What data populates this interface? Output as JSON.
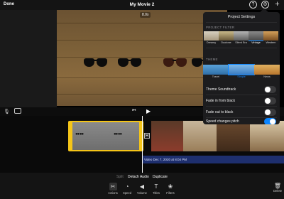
{
  "header": {
    "done_label": "Done",
    "title": "My Movie 2",
    "help_icon": "?",
    "settings_icon": "⚙",
    "add_icon": "+"
  },
  "viewer": {
    "speed_badge": "8.0x"
  },
  "controls": {
    "mic_icon": "🎙",
    "skip_back_icon": "⏮",
    "play_icon": "▶"
  },
  "timeline": {
    "audio_label": "Video Dec 7, 2020 at 8:04 PM",
    "transition_icon": "⋈"
  },
  "actions": {
    "split": "Split",
    "detach_audio": "Detach Audio",
    "duplicate": "Duplicate"
  },
  "toolbar": {
    "tools": [
      {
        "label": "Actions",
        "icon": "✂"
      },
      {
        "label": "Speed",
        "icon": "◔"
      },
      {
        "label": "Volume",
        "icon": "◀"
      },
      {
        "label": "Titles",
        "icon": "T"
      },
      {
        "label": "Filters",
        "icon": "❀"
      }
    ],
    "delete": {
      "label": "Delete",
      "icon": "🗑"
    }
  },
  "settings": {
    "title": "Project Settings",
    "filter_section": "PROJECT FILTER",
    "filters": [
      "Dreamy",
      "Duotone",
      "Silent Era",
      "Vintage",
      "Western"
    ],
    "selected_filter": "Vintage",
    "theme_section": "THEME",
    "themes": [
      "Travel",
      "Simple",
      "News"
    ],
    "selected_theme": "Simple",
    "options": [
      {
        "label": "Theme Soundtrack",
        "on": false
      },
      {
        "label": "Fade in from black",
        "on": false
      },
      {
        "label": "Fade out to black",
        "on": false
      },
      {
        "label": "Speed changes pitch",
        "on": true
      }
    ]
  },
  "colors": {
    "accent": "#0a84ff",
    "clip_selection": "#f5c518",
    "audio_track": "#1e2f6e"
  }
}
